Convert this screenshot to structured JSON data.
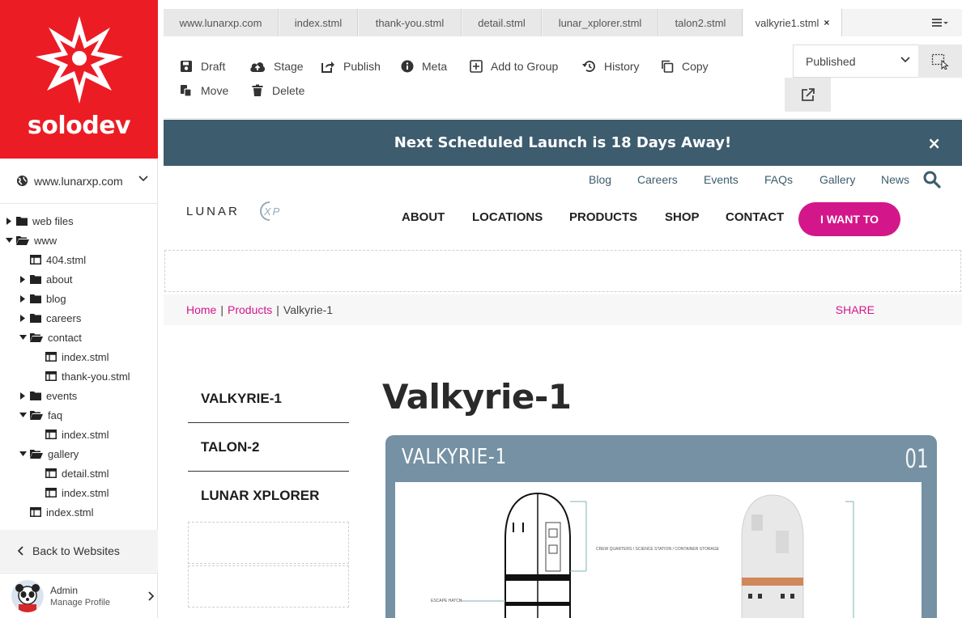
{
  "brand": {
    "name": "solodev",
    "brand_color": "#ec1c24"
  },
  "site_selector": {
    "value": "www.lunarxp.com",
    "icon": "globe-icon"
  },
  "tree": {
    "items": [
      {
        "label": "web files",
        "type": "folder",
        "expanded": false,
        "depth": 0
      },
      {
        "label": "www",
        "type": "folder",
        "expanded": true,
        "depth": 0
      },
      {
        "label": "404.stml",
        "type": "file",
        "depth": 1
      },
      {
        "label": "about",
        "type": "folder",
        "expanded": false,
        "depth": 1
      },
      {
        "label": "blog",
        "type": "folder",
        "expanded": false,
        "depth": 1
      },
      {
        "label": "careers",
        "type": "folder",
        "expanded": false,
        "depth": 1
      },
      {
        "label": "contact",
        "type": "folder",
        "expanded": true,
        "depth": 1
      },
      {
        "label": "index.stml",
        "type": "file",
        "depth": 2
      },
      {
        "label": "thank-you.stml",
        "type": "file",
        "depth": 2
      },
      {
        "label": "events",
        "type": "folder",
        "expanded": false,
        "depth": 1
      },
      {
        "label": "faq",
        "type": "folder",
        "expanded": true,
        "depth": 1
      },
      {
        "label": "index.stml",
        "type": "file",
        "depth": 2
      },
      {
        "label": "gallery",
        "type": "folder",
        "expanded": true,
        "depth": 1
      },
      {
        "label": "detail.stml",
        "type": "file",
        "depth": 2
      },
      {
        "label": "index.stml",
        "type": "file",
        "depth": 2
      },
      {
        "label": "index.stml",
        "type": "file",
        "depth": 1
      }
    ]
  },
  "back_label": "Back to Websites",
  "user": {
    "name": "Admin",
    "link": "Manage Profile"
  },
  "tabs": [
    {
      "label": "www.lunarxp.com",
      "active": false
    },
    {
      "label": "index.stml",
      "active": false
    },
    {
      "label": "thank-you.stml",
      "active": false
    },
    {
      "label": "detail.stml",
      "active": false
    },
    {
      "label": "lunar_xplorer.stml",
      "active": false
    },
    {
      "label": "talon2.stml",
      "active": false
    },
    {
      "label": "valkyrie1.stml",
      "active": true
    }
  ],
  "tab_close_glyph": "×",
  "toolbar": {
    "draft": "Draft",
    "stage": "Stage",
    "publish": "Publish",
    "meta": "Meta",
    "add_to_group": "Add to Group",
    "history": "History",
    "copy": "Copy",
    "move": "Move",
    "delete": "Delete",
    "status": "Published"
  },
  "preview": {
    "alert": "Next Scheduled Launch is 18 Days Away!",
    "alert_close": "×",
    "alert_color": "#3d5c6e",
    "accent_color": "#d4168b",
    "logo": {
      "word": "LUNAR",
      "mark": "XP"
    },
    "util_nav": [
      "Blog",
      "Careers",
      "Events",
      "FAQs",
      "Gallery",
      "News"
    ],
    "main_nav": [
      "ABOUT",
      "LOCATIONS",
      "PRODUCTS",
      "SHOP",
      "CONTACT"
    ],
    "cta": "I WANT TO",
    "breadcrumb": {
      "home": "Home",
      "separator": "|",
      "products": "Products",
      "current": "Valkyrie-1"
    },
    "share": "SHARE",
    "side_menu": [
      "VALKYRIE-1",
      "TALON-2",
      "LUNAR XPLORER"
    ],
    "title": "Valkyrie-1",
    "card": {
      "name": "VALKYRIE-1",
      "number": "01",
      "label_1": "CREW QUARTERS / SCIENCE STATION / CONTAINER STORAGE",
      "label_2": "ESCAPE HATCH"
    }
  }
}
